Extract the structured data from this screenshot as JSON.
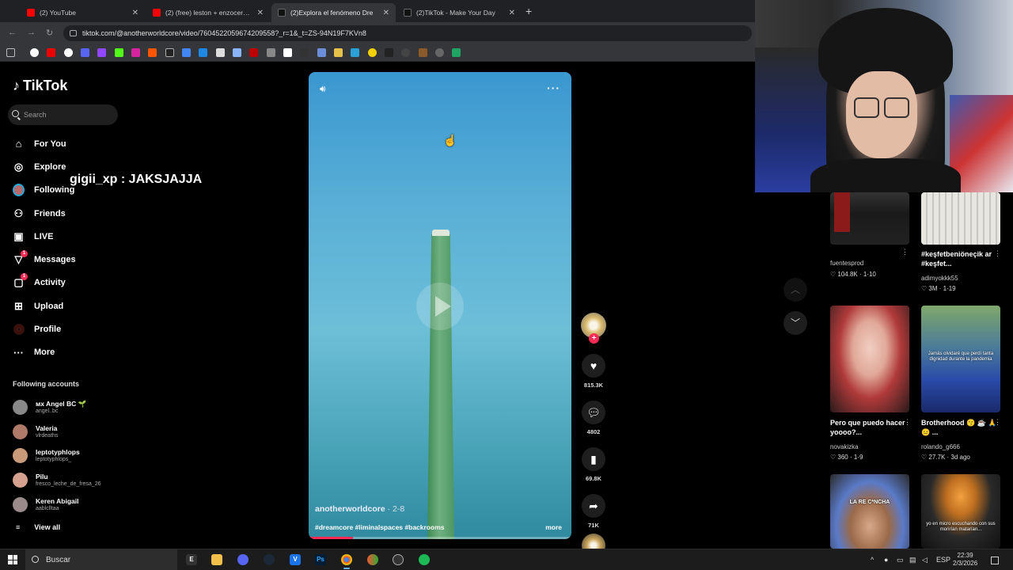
{
  "browser": {
    "tabs": [
      {
        "title": "(2) YouTube",
        "color": "#ff0000",
        "active": false
      },
      {
        "title": "(2) (free) leston + enzocerobull",
        "color": "#ff0000",
        "active": false
      },
      {
        "title": "(2)Explora el fenómeno Dre",
        "color": "#111111",
        "active": true
      },
      {
        "title": "(2)TikTok - Make Your Day",
        "color": "#111111",
        "active": false
      }
    ],
    "new_tab": "+",
    "url": "tiktok.com/@anotherworldcore/video/7604522059674209558?_r=1&_t=ZS-94N19F7KVn8"
  },
  "tiktok": {
    "logo": "TikTok",
    "search_placeholder": "Search",
    "nav": [
      {
        "label": "For You",
        "icon": "home-icon",
        "glyph": "⌂"
      },
      {
        "label": "Explore",
        "icon": "compass-icon",
        "glyph": "◎"
      },
      {
        "label": "Following",
        "icon": "following-avatar-icon",
        "glyph": "●"
      },
      {
        "label": "Friends",
        "icon": "friends-icon",
        "glyph": "⚇"
      },
      {
        "label": "LIVE",
        "icon": "live-icon",
        "glyph": "▣"
      },
      {
        "label": "Messages",
        "icon": "messages-icon",
        "glyph": "▽",
        "badge": "1"
      },
      {
        "label": "Activity",
        "icon": "activity-icon",
        "glyph": "▢",
        "badge": "1"
      },
      {
        "label": "Upload",
        "icon": "upload-icon",
        "glyph": "⊞"
      },
      {
        "label": "Profile",
        "icon": "profile-icon",
        "glyph": "●"
      },
      {
        "label": "More",
        "icon": "more-icon",
        "glyph": "···"
      }
    ],
    "overlay_chat": "gigii_xp : JAKSJAJJA",
    "following_title": "Following accounts",
    "following": [
      {
        "name": "ᴍx Angel BC 🌱",
        "handle": "angel..bc",
        "color": "#888888"
      },
      {
        "name": "Valeria",
        "handle": "vlrdeaths",
        "color": "#b07a6a"
      },
      {
        "name": "leptotyphlops",
        "handle": "leptotyphlops_",
        "color": "#c99a7a"
      },
      {
        "name": "Pilu",
        "handle": "fresco_leche_de_fresa_26",
        "color": "#d6a090"
      },
      {
        "name": "Keren Abigail",
        "handle": "aablclltaa",
        "color": "#9a8a8a"
      }
    ],
    "view_all": "View all",
    "video": {
      "author": "anotherworldcore",
      "date": "· 2-8",
      "tags": "#dreamcore #liminalspaces #backrooms",
      "more": "more",
      "progress": 0.17
    },
    "actions": {
      "likes": "815.3K",
      "comments": "4802",
      "saves": "69.8K",
      "shares": "71K"
    },
    "grid": [
      {
        "caption": "",
        "user": "fuentesprod",
        "stat": "♡ 104.8K · 1-10"
      },
      {
        "caption": "#keşfetbeniöneçik ar #keşfet...",
        "user": "adimyokkk55",
        "stat": "♡ 3M · 1-19"
      },
      {
        "caption": "Pero que puedo hacer yoooo?...",
        "user": "novakizka",
        "stat": "♡ 360 · 1-9"
      },
      {
        "caption": "Brotherhood 😗 ☕ 🙏 😐 ...",
        "user": "rolando_g666",
        "stat": "♡ 27.7K · 3d ago"
      },
      {
        "caption": "",
        "user": "",
        "stat": ""
      },
      {
        "caption": "",
        "user": "",
        "stat": ""
      }
    ],
    "thumb_texts": {
      "t4": "Jamás olvidaré que perdí tanta dignidad durante la pandemia",
      "t5": "LA RE C*NCHA",
      "t6": "yo en micro escuchando con sus morirían matarían..."
    }
  },
  "taskbar": {
    "search": "Buscar",
    "lang": "ESP",
    "time": "22:39",
    "date": "2/3/2026"
  }
}
